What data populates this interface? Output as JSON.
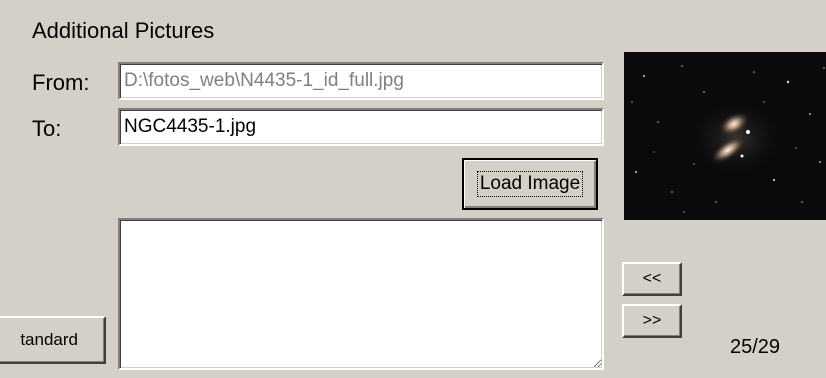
{
  "section": {
    "title": "Additional Pictures"
  },
  "form": {
    "from_label": "From:",
    "from_value": "D:\\fotos_web\\N4435-1_id_full.jpg",
    "to_label": "To:",
    "to_value": "NGC4435-1.jpg",
    "description_value": ""
  },
  "buttons": {
    "load_image": "Load Image",
    "standard": "tandard",
    "prev": "<<",
    "next": ">>"
  },
  "navigator": {
    "counter": "25/29"
  },
  "preview": {
    "subject": "galaxy-pair-starfield"
  },
  "colors": {
    "window_bg": "#d4d0c8",
    "field_bg": "#ffffff",
    "disabled_text": "#808080",
    "preview_bg": "#0a0a0c"
  }
}
